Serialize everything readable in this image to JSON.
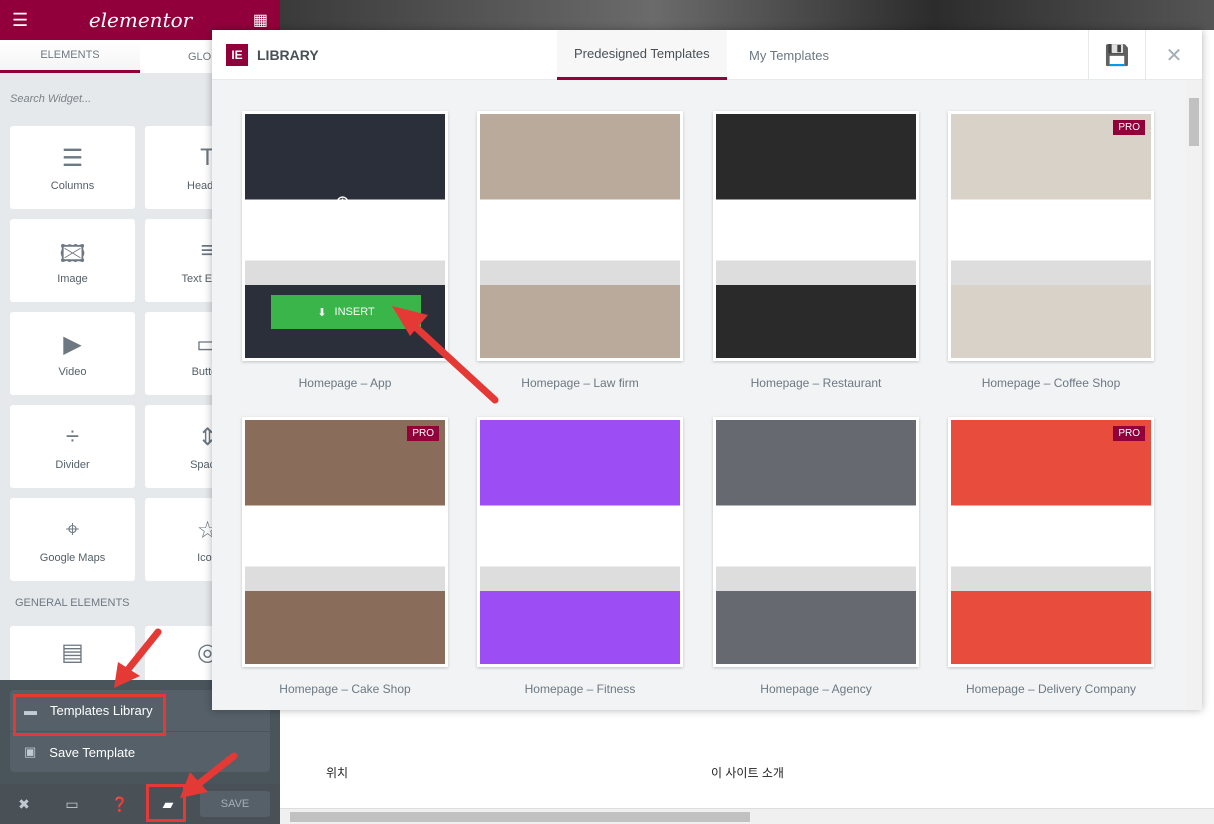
{
  "panel": {
    "logo": "elementor",
    "tabs": [
      "ELEMENTS",
      "GLOBAL"
    ],
    "search_placeholder": "Search Widget...",
    "widgets": [
      {
        "label": "Columns",
        "icon": "columns-icon"
      },
      {
        "label": "Heading",
        "icon": "heading-icon"
      },
      {
        "label": "Image",
        "icon": "image-icon"
      },
      {
        "label": "Text Editor",
        "icon": "text-editor-icon"
      },
      {
        "label": "Video",
        "icon": "video-icon"
      },
      {
        "label": "Button",
        "icon": "button-icon"
      },
      {
        "label": "Divider",
        "icon": "divider-icon"
      },
      {
        "label": "Spacer",
        "icon": "spacer-icon"
      },
      {
        "label": "Google Maps",
        "icon": "map-icon"
      },
      {
        "label": "Icon",
        "icon": "star-icon"
      }
    ],
    "section_title": "GENERAL ELEMENTS",
    "menu": [
      "Templates Library",
      "Save Template"
    ],
    "footer": {
      "save": "SAVE"
    }
  },
  "library": {
    "title": "LIBRARY",
    "tabs": [
      "Predesigned Templates",
      "My Templates"
    ],
    "insert_label": "INSERT",
    "pro_badge": "PRO",
    "templates": [
      {
        "name": "Homepage – App",
        "pro": false,
        "color": "#2b2f3a"
      },
      {
        "name": "Homepage – Law firm",
        "pro": false,
        "color": "#b9aa9b"
      },
      {
        "name": "Homepage – Restaurant",
        "pro": false,
        "color": "#2a2a2a"
      },
      {
        "name": "Homepage – Coffee Shop",
        "pro": true,
        "color": "#d9d2c8"
      },
      {
        "name": "Homepage – Cake Shop",
        "pro": true,
        "color": "#8a6c5a"
      },
      {
        "name": "Homepage – Fitness",
        "pro": false,
        "color": "#9c4df4"
      },
      {
        "name": "Homepage – Agency",
        "pro": false,
        "color": "#666a70"
      },
      {
        "name": "Homepage – Delivery Company",
        "pro": true,
        "color": "#e84c3d"
      }
    ]
  },
  "page": {
    "col1": "위치",
    "col2": "이 사이트 소개"
  },
  "colors": {
    "brand": "#92003b",
    "insert": "#39b54a",
    "annotation": "#e53935"
  }
}
